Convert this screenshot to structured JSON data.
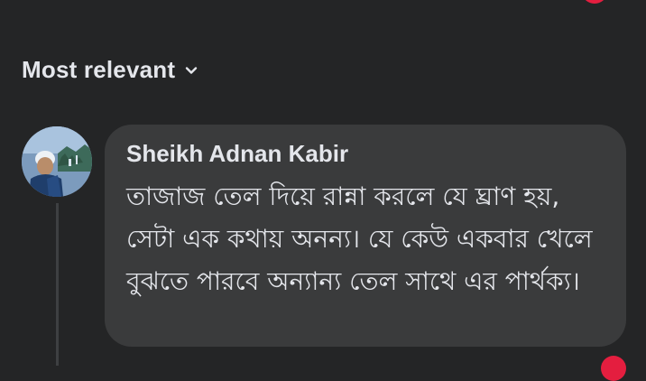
{
  "sort": {
    "label": "Most relevant",
    "icon": "chevron-down-icon"
  },
  "comment": {
    "author": "Sheikh Adnan Kabir",
    "text": "তাজাজ তেল দিয়ে রান্না করলে যে ঘ্রাণ হয়, সেটা এক কথায় অনন্য। যে কেউ একবার খেলে বুঝতে পারবে অন্যান্য তেল সাথে এর পার্থক্য।",
    "avatar_icon": "profile-photo"
  },
  "colors": {
    "background": "#242526",
    "bubble": "#3a3b3c",
    "text": "#e4e6eb",
    "accent_red": "#e41e3f"
  }
}
